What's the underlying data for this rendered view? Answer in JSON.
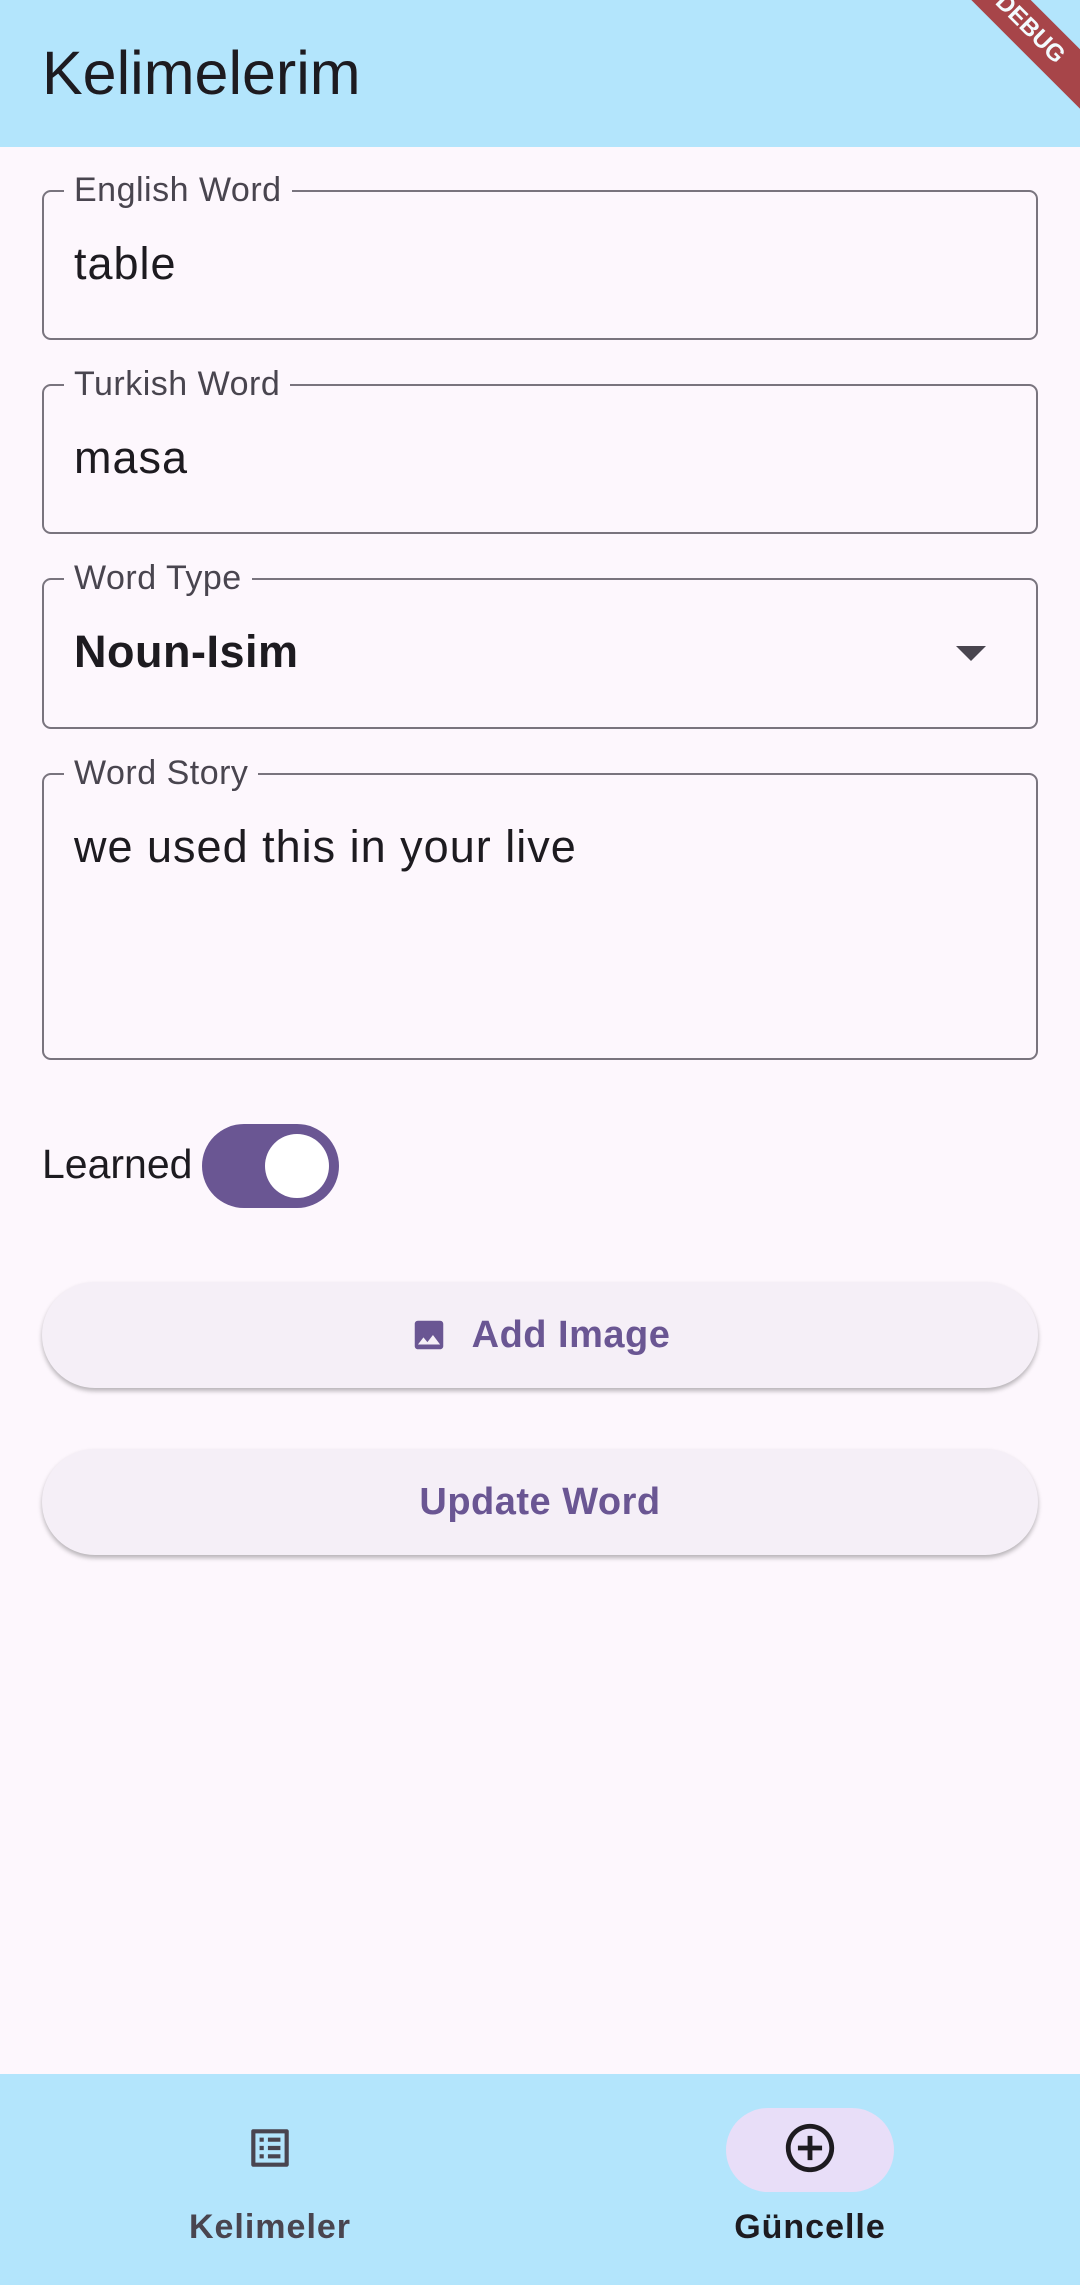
{
  "app_bar": {
    "title": "Kelimelerim",
    "debug_banner": "DEBUG"
  },
  "form": {
    "english_word": {
      "label": "English Word",
      "value": "table"
    },
    "turkish_word": {
      "label": "Turkish Word",
      "value": "masa"
    },
    "word_type": {
      "label": "Word Type",
      "selected": "Noun-Isim"
    },
    "word_story": {
      "label": "Word Story",
      "value": "we used this in your live"
    },
    "learned": {
      "label": "Learned",
      "on": true
    }
  },
  "buttons": {
    "add_image": {
      "label": "Add Image",
      "icon": "image-icon"
    },
    "update_word": {
      "label": "Update Word"
    }
  },
  "bottom_nav": {
    "items": [
      {
        "label": "Kelimeler",
        "icon": "list-icon",
        "active": false
      },
      {
        "label": "Güncelle",
        "icon": "add-circle-icon",
        "active": true
      }
    ]
  },
  "colors": {
    "app_bar": "#b3e5fc",
    "background": "#fdf7fd",
    "accent": "#6a5693",
    "active_indicator": "#e8def8"
  }
}
